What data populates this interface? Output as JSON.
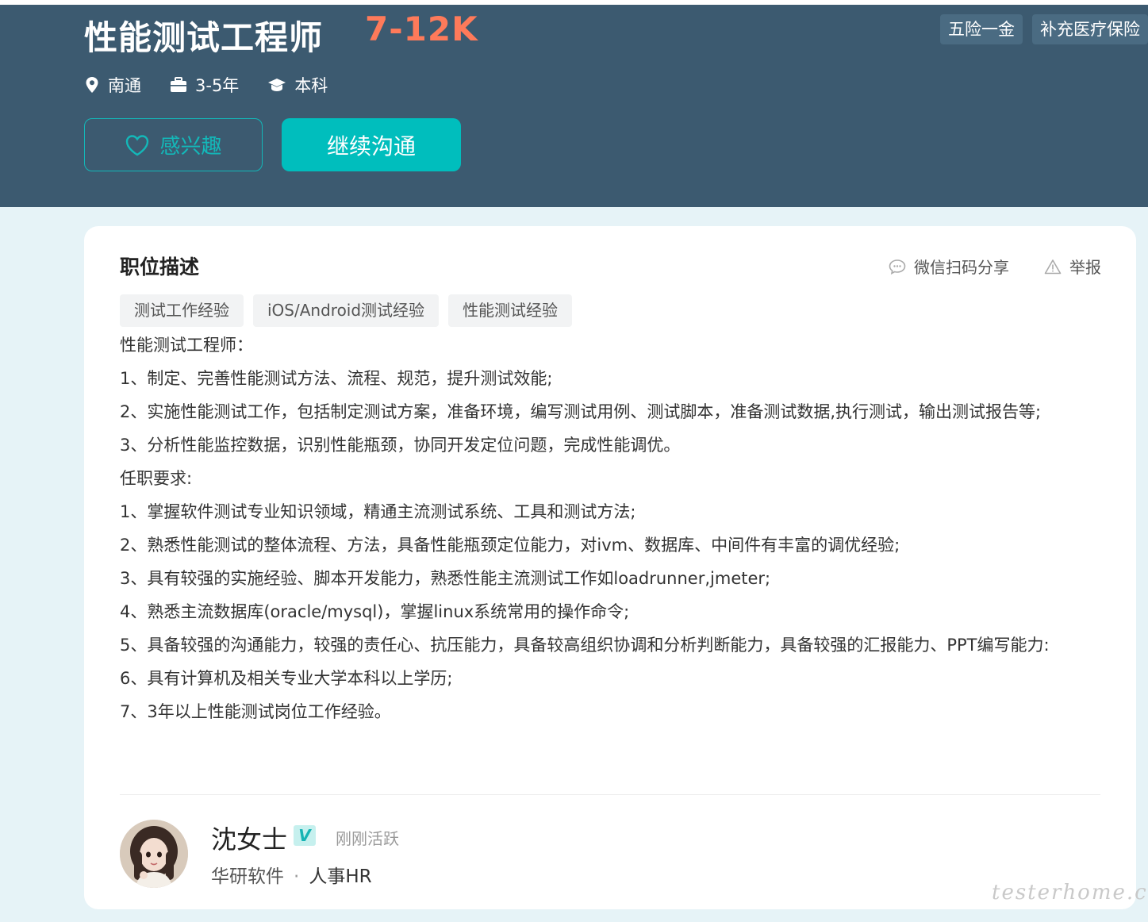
{
  "job": {
    "title": "性能测试工程师",
    "salary": "7-12K",
    "benefits": [
      "五险一金",
      "补充医疗保险"
    ],
    "meta": {
      "city": "南通",
      "experience": "3-5年",
      "degree": "本科"
    }
  },
  "actions": {
    "interest_label": "感兴趣",
    "chat_label": "继续沟通"
  },
  "description_section": {
    "title": "职位描述",
    "share_label": "微信扫码分享",
    "report_label": "举报",
    "skill_tags": [
      "测试工作经验",
      "iOS/Android测试经验",
      "性能测试经验"
    ],
    "lines": [
      "性能测试工程师：",
      "1、制定、完善性能测试方法、流程、规范，提升测试效能;",
      "2、实施性能测试工作，包括制定测试方案，准备环境，编写测试用例、测试脚本，准备测试数据,执行测试，输出测试报告等;",
      "3、分析性能监控数据，识别性能瓶颈，协同开发定位问题，完成性能调优。",
      "任职要求:",
      "1、掌握软件测试专业知识领域，精通主流测试系统、工具和测试方法;",
      "2、熟悉性能测试的整体流程、方法，具备性能瓶颈定位能力，对ivm、数据库、中间件有丰富的调优经验;",
      "3、具有较强的实施经验、脚本开发能力，熟悉性能主流测试工作如loadrunner,jmeter;",
      "4、熟悉主流数据库(oracle/mysql)，掌握linux系统常用的操作命令;",
      "5、具备较强的沟通能力，较强的责任心、抗压能力，具备较高组织协调和分析判断能力，具备较强的汇报能力、PPT编写能力:",
      "6、具有计算机及相关专业大学本科以上学历;",
      "7、3年以上性能测试岗位工作经验。"
    ]
  },
  "recruiter": {
    "name": "沈女士",
    "verified_badge": "V",
    "status": "刚刚活跃",
    "company": "华研软件",
    "separator": "·",
    "role": "人事HR"
  },
  "watermark": "testerhome.com",
  "colors": {
    "header_bg": "#3c5a70",
    "salary": "#fe7a5a",
    "accent": "#00bebd",
    "page_bg": "#e6f3f7"
  }
}
